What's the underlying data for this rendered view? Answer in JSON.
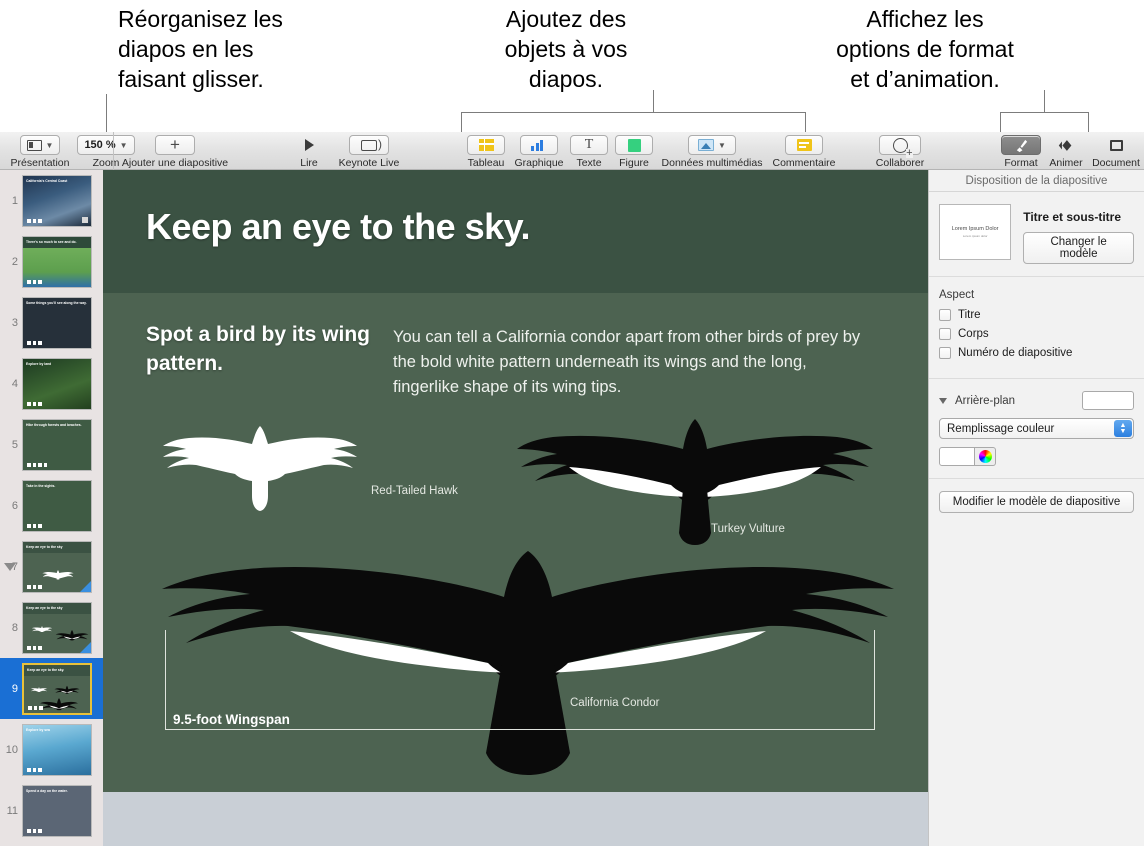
{
  "callouts": [
    {
      "id": "reorder",
      "text": "Réorganisez les\ndiapos en les\nfaisant glisser."
    },
    {
      "id": "add-objects",
      "text": "Ajoutez des\nobjets à vos\ndiapos."
    },
    {
      "id": "format-options",
      "text": "Affichez les\noptions de format\net d’animation."
    }
  ],
  "toolbar": {
    "view_label": "Présentation",
    "zoom_label": "Zoom",
    "zoom_value": "150 %",
    "add_slide_label": "Ajouter une diapositive",
    "play_label": "Lire",
    "keynote_live_label": "Keynote Live",
    "table_label": "Tableau",
    "chart_label": "Graphique",
    "text_label": "Texte",
    "shape_label": "Figure",
    "media_label": "Données multimédias",
    "comment_label": "Commentaire",
    "collaborate_label": "Collaborer",
    "format_label": "Format",
    "animate_label": "Animer",
    "document_label": "Document"
  },
  "navigator": {
    "slides": [
      {
        "number": "1",
        "title": "California's Central Coast",
        "style": "photo-coast",
        "dots": 3,
        "badge": true,
        "corner": false
      },
      {
        "number": "2",
        "title": "There's so much to see and do.",
        "style": "map-green",
        "dots": 3,
        "badge": false,
        "corner": false
      },
      {
        "number": "3",
        "title": "Some things you'll see along the way.",
        "style": "dark-photo",
        "dots": 3,
        "badge": false,
        "corner": false
      },
      {
        "number": "4",
        "title": "Explore by land",
        "style": "forest",
        "dots": 3,
        "badge": false,
        "corner": false
      },
      {
        "number": "5",
        "title": "Hike through forests and beaches.",
        "style": "green-collage",
        "dots": 4,
        "badge": false,
        "corner": false
      },
      {
        "number": "6",
        "title": "Take in the sights.",
        "style": "three-photos",
        "dots": 3,
        "badge": false,
        "corner": false
      },
      {
        "number": "7",
        "title": "Keep an eye to the sky",
        "style": "bird-white",
        "dots": 3,
        "badge": false,
        "corner": true
      },
      {
        "number": "8",
        "title": "Keep an eye to the sky",
        "style": "bird-two",
        "dots": 3,
        "badge": false,
        "corner": true
      },
      {
        "number": "9",
        "title": "Keep an eye to the sky.",
        "style": "bird-three",
        "dots": 3,
        "badge": false,
        "corner": false,
        "selected": true
      },
      {
        "number": "10",
        "title": "Explore by sea",
        "style": "kayak",
        "dots": 3,
        "badge": false,
        "corner": false
      },
      {
        "number": "11",
        "title": "Spend a day on the water.",
        "style": "kayaks-two",
        "dots": 3,
        "badge": false,
        "corner": false
      }
    ],
    "group_indicator_slide": "7"
  },
  "slide": {
    "title": "Keep an eye to the sky.",
    "heading": "Spot a bird by its wing pattern.",
    "body": "You can tell a California condor apart from other birds of prey by the bold white pattern underneath its wings and the long, fingerlike shape of its wing tips.",
    "labels": {
      "hawk": "Red-Tailed Hawk",
      "vulture": "Turkey Vulture",
      "condor": "California Condor",
      "wingspan": "9.5-foot Wingspan"
    },
    "colors": {
      "band": "#3b5243",
      "body": "#4d6351"
    }
  },
  "inspector": {
    "header": "Disposition de la diapositive",
    "layout_thumb_main": "Lorem Ipsum Dolor",
    "layout_thumb_sub": "Lorem ipsum dolor",
    "layout_name": "Titre et sous-titre",
    "change_master_label": "Changer le modèle",
    "appearance_title": "Aspect",
    "checkboxes": [
      {
        "label": "Titre",
        "checked": false
      },
      {
        "label": "Corps",
        "checked": false
      },
      {
        "label": "Numéro de diapositive",
        "checked": false
      }
    ],
    "background_title": "Arrière-plan",
    "fill_option": "Remplissage couleur",
    "edit_master_label": "Modifier le modèle de diapositive"
  }
}
